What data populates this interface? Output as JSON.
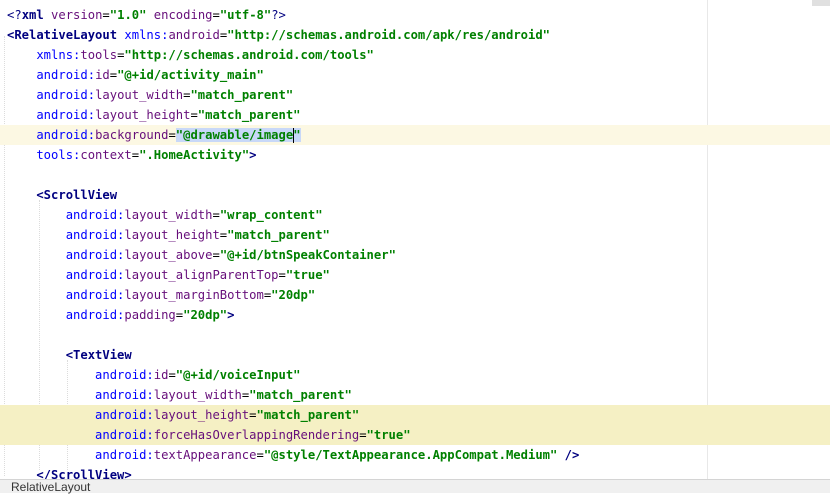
{
  "editor": {
    "lines": [
      {
        "parts": [
          [
            "pi",
            "<?"
          ],
          [
            "tag",
            "xml "
          ],
          [
            "attr",
            "version"
          ],
          [
            "decl",
            "="
          ],
          [
            "val",
            "\"1.0\""
          ],
          [
            "attr",
            " encoding"
          ],
          [
            "decl",
            "="
          ],
          [
            "val",
            "\"utf-8\""
          ],
          [
            "pi",
            "?>"
          ]
        ]
      },
      {
        "parts": [
          [
            "tag",
            "<RelativeLayout "
          ],
          [
            "attr-ns",
            "xmlns:"
          ],
          [
            "attr",
            "android"
          ],
          [
            "decl",
            "="
          ],
          [
            "val",
            "\"http://schemas.android.com/apk/res/android\""
          ]
        ]
      },
      {
        "parts": [
          [
            "attr-ns",
            "    xmlns:"
          ],
          [
            "attr",
            "tools"
          ],
          [
            "decl",
            "="
          ],
          [
            "val",
            "\"http://schemas.android.com/tools\""
          ]
        ]
      },
      {
        "parts": [
          [
            "attr-ns",
            "    android:"
          ],
          [
            "attr",
            "id"
          ],
          [
            "decl",
            "="
          ],
          [
            "val",
            "\"@+id/activity_main\""
          ]
        ]
      },
      {
        "parts": [
          [
            "attr-ns",
            "    android:"
          ],
          [
            "attr",
            "layout_width"
          ],
          [
            "decl",
            "="
          ],
          [
            "val",
            "\"match_parent\""
          ]
        ]
      },
      {
        "parts": [
          [
            "attr-ns",
            "    android:"
          ],
          [
            "attr",
            "layout_height"
          ],
          [
            "decl",
            "="
          ],
          [
            "val",
            "\"match_parent\""
          ]
        ]
      },
      {
        "parts": [
          [
            "attr-ns",
            "    android:"
          ],
          [
            "attr",
            "background"
          ],
          [
            "decl",
            "="
          ],
          [
            "val",
            "\"@drawable/image\""
          ]
        ]
      },
      {
        "parts": [
          [
            "attr-ns",
            "    tools:"
          ],
          [
            "attr",
            "context"
          ],
          [
            "decl",
            "="
          ],
          [
            "val",
            "\".HomeActivity\""
          ],
          [
            "tag",
            ">"
          ]
        ]
      },
      {
        "parts": [
          [
            "decl",
            " "
          ]
        ]
      },
      {
        "parts": [
          [
            "tag",
            "    <ScrollView"
          ]
        ]
      },
      {
        "parts": [
          [
            "attr-ns",
            "        android:"
          ],
          [
            "attr",
            "layout_width"
          ],
          [
            "decl",
            "="
          ],
          [
            "val",
            "\"wrap_content\""
          ]
        ]
      },
      {
        "parts": [
          [
            "attr-ns",
            "        android:"
          ],
          [
            "attr",
            "layout_height"
          ],
          [
            "decl",
            "="
          ],
          [
            "val",
            "\"match_parent\""
          ]
        ]
      },
      {
        "parts": [
          [
            "attr-ns",
            "        android:"
          ],
          [
            "attr",
            "layout_above"
          ],
          [
            "decl",
            "="
          ],
          [
            "val",
            "\"@+id/btnSpeakContainer\""
          ]
        ]
      },
      {
        "parts": [
          [
            "attr-ns",
            "        android:"
          ],
          [
            "attr",
            "layout_alignParentTop"
          ],
          [
            "decl",
            "="
          ],
          [
            "val",
            "\"true\""
          ]
        ]
      },
      {
        "parts": [
          [
            "attr-ns",
            "        android:"
          ],
          [
            "attr",
            "layout_marginBottom"
          ],
          [
            "decl",
            "="
          ],
          [
            "val",
            "\"20dp\""
          ]
        ]
      },
      {
        "parts": [
          [
            "attr-ns",
            "        android:"
          ],
          [
            "attr",
            "padding"
          ],
          [
            "decl",
            "="
          ],
          [
            "val",
            "\"20dp\""
          ],
          [
            "tag",
            ">"
          ]
        ]
      },
      {
        "parts": [
          [
            "decl",
            " "
          ]
        ]
      },
      {
        "parts": [
          [
            "tag",
            "        <TextView"
          ]
        ]
      },
      {
        "parts": [
          [
            "attr-ns",
            "            android:"
          ],
          [
            "attr",
            "id"
          ],
          [
            "decl",
            "="
          ],
          [
            "val",
            "\"@+id/voiceInput\""
          ]
        ]
      },
      {
        "parts": [
          [
            "attr-ns",
            "            android:"
          ],
          [
            "attr",
            "layout_width"
          ],
          [
            "decl",
            "="
          ],
          [
            "val",
            "\"match_parent\""
          ]
        ]
      },
      {
        "parts": [
          [
            "attr-ns",
            "            android:"
          ],
          [
            "attr",
            "layout_height"
          ],
          [
            "decl",
            "="
          ],
          [
            "val",
            "\"match_parent\""
          ]
        ]
      },
      {
        "parts": [
          [
            "attr-ns",
            "            android:"
          ],
          [
            "attr",
            "forceHasOverlappingRendering"
          ],
          [
            "decl",
            "="
          ],
          [
            "val",
            "\"true\""
          ]
        ]
      },
      {
        "parts": [
          [
            "attr-ns",
            "            android:"
          ],
          [
            "attr",
            "textAppearance"
          ],
          [
            "decl",
            "="
          ],
          [
            "val",
            "\"@style/TextAppearance.AppCompat.Medium\""
          ],
          [
            "tag",
            " />"
          ]
        ]
      },
      {
        "parts": [
          [
            "tag",
            "    </ScrollView>"
          ]
        ]
      }
    ]
  },
  "statusbar": {
    "breadcrumb": "RelativeLayout"
  }
}
